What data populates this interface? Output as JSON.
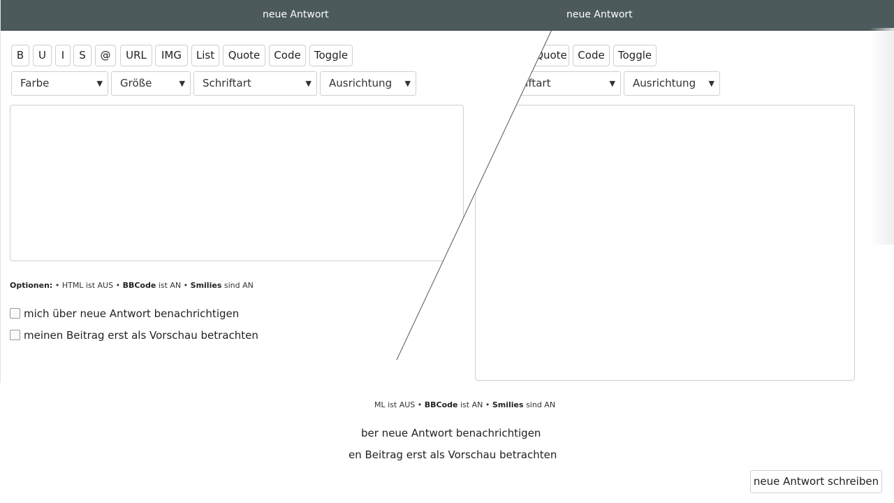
{
  "header": {
    "title": "neue Antwort"
  },
  "toolbar": {
    "buttons": [
      "B",
      "U",
      "I",
      "S",
      "@",
      "URL",
      "IMG",
      "List",
      "Quote",
      "Code",
      "Toggle"
    ],
    "right_visible_buttons": [
      "Quote",
      "Code",
      "Toggle"
    ]
  },
  "selects": {
    "farbe": "Farbe",
    "groesse": "Größe",
    "schriftart": "Schriftart",
    "ausrichtung": "Ausrichtung",
    "schriftart_partial": "riftart"
  },
  "options": {
    "label": "Optionen:",
    "html": "HTML ist AUS",
    "bbcode": "BBCode",
    "bbcode_state": "ist AN",
    "smilies": "Smilies",
    "smilies_state": "sind AN",
    "html_partial": "ML ist AUS"
  },
  "checkboxes": {
    "notify": "mich über neue Antwort benachrichtigen",
    "preview": "meinen Beitrag erst als Vorschau betrachten",
    "notify_partial": "ber neue Antwort benachrichtigen",
    "preview_partial": "en Beitrag erst als Vorschau betrachten"
  },
  "submit": {
    "label": "neue Antwort schreiben"
  },
  "icons": {
    "dropdown_arrow": "▼"
  },
  "colors": {
    "header_bg": "#4d5a5b",
    "border": "#cfcfcf"
  }
}
